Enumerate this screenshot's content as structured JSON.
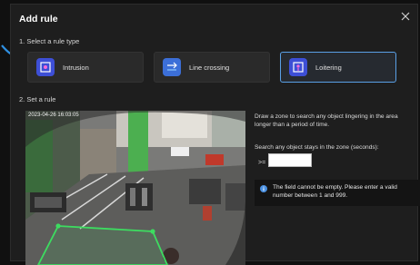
{
  "dialog": {
    "title": "Add rule",
    "close_icon": "close-icon"
  },
  "steps": {
    "step1_label": "1. Select a rule type",
    "step2_label": "2. Set a rule"
  },
  "rule_types": [
    {
      "label": "Intrusion",
      "icon": "intrusion-icon",
      "color": "#3d4fd6"
    },
    {
      "label": "Line crossing",
      "icon": "line-crossing-icon",
      "color": "#3c6fd8"
    },
    {
      "label": "Loitering",
      "icon": "loitering-icon",
      "color": "#3d4fd6",
      "selected": true
    }
  ],
  "camera": {
    "timestamp": "2023-04-26 16:03:05"
  },
  "settings": {
    "description": "Draw a zone to search any object lingering in the area longer than a period of time.",
    "stays_label": "Search any object stays in the zone (seconds):",
    "operator": ">=",
    "seconds_value": ""
  },
  "error": {
    "icon": "info-icon",
    "message": "The field cannot be empty. Please enter a valid number between 1 and 999."
  },
  "colors": {
    "accent": "#5aa0e6",
    "zone": "#3ddc60",
    "background": "#1e1e1e"
  }
}
